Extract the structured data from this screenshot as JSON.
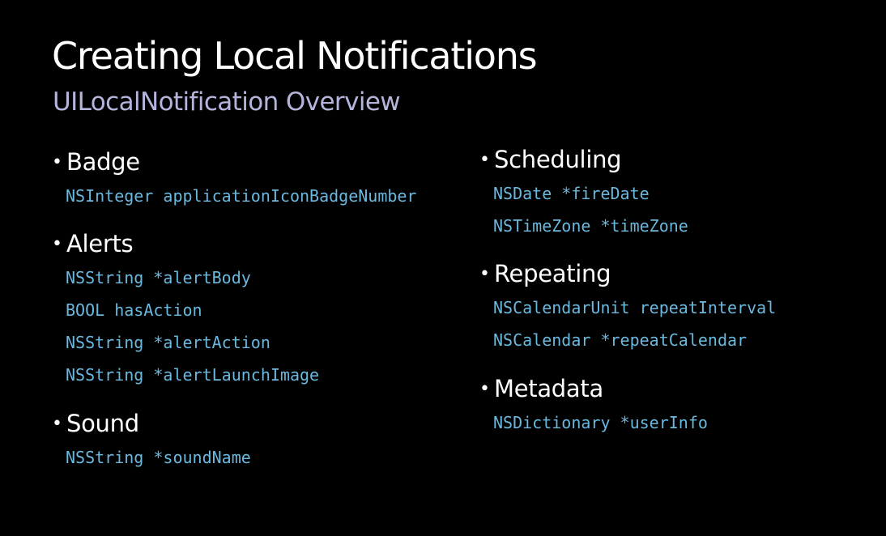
{
  "slide": {
    "title": "Creating Local Notifications",
    "subtitle": "UILocalNotification Overview",
    "colors": {
      "background": "#000000",
      "title": "#ffffff",
      "subtitle": "#b3b5dc",
      "code": "#6bb8de"
    }
  },
  "left_sections": [
    {
      "heading": "Badge",
      "properties": [
        "NSInteger applicationIconBadgeNumber"
      ]
    },
    {
      "heading": "Alerts",
      "properties": [
        "NSString *alertBody",
        "BOOL hasAction",
        "NSString *alertAction",
        "NSString *alertLaunchImage"
      ]
    },
    {
      "heading": "Sound",
      "properties": [
        "NSString *soundName"
      ]
    }
  ],
  "right_sections": [
    {
      "heading": "Scheduling",
      "properties": [
        "NSDate *fireDate",
        "NSTimeZone *timeZone"
      ]
    },
    {
      "heading": "Repeating",
      "properties": [
        "NSCalendarUnit repeatInterval",
        "NSCalendar *repeatCalendar"
      ]
    },
    {
      "heading": "Metadata",
      "properties": [
        "NSDictionary *userInfo"
      ]
    }
  ],
  "bullet_glyph": "•"
}
